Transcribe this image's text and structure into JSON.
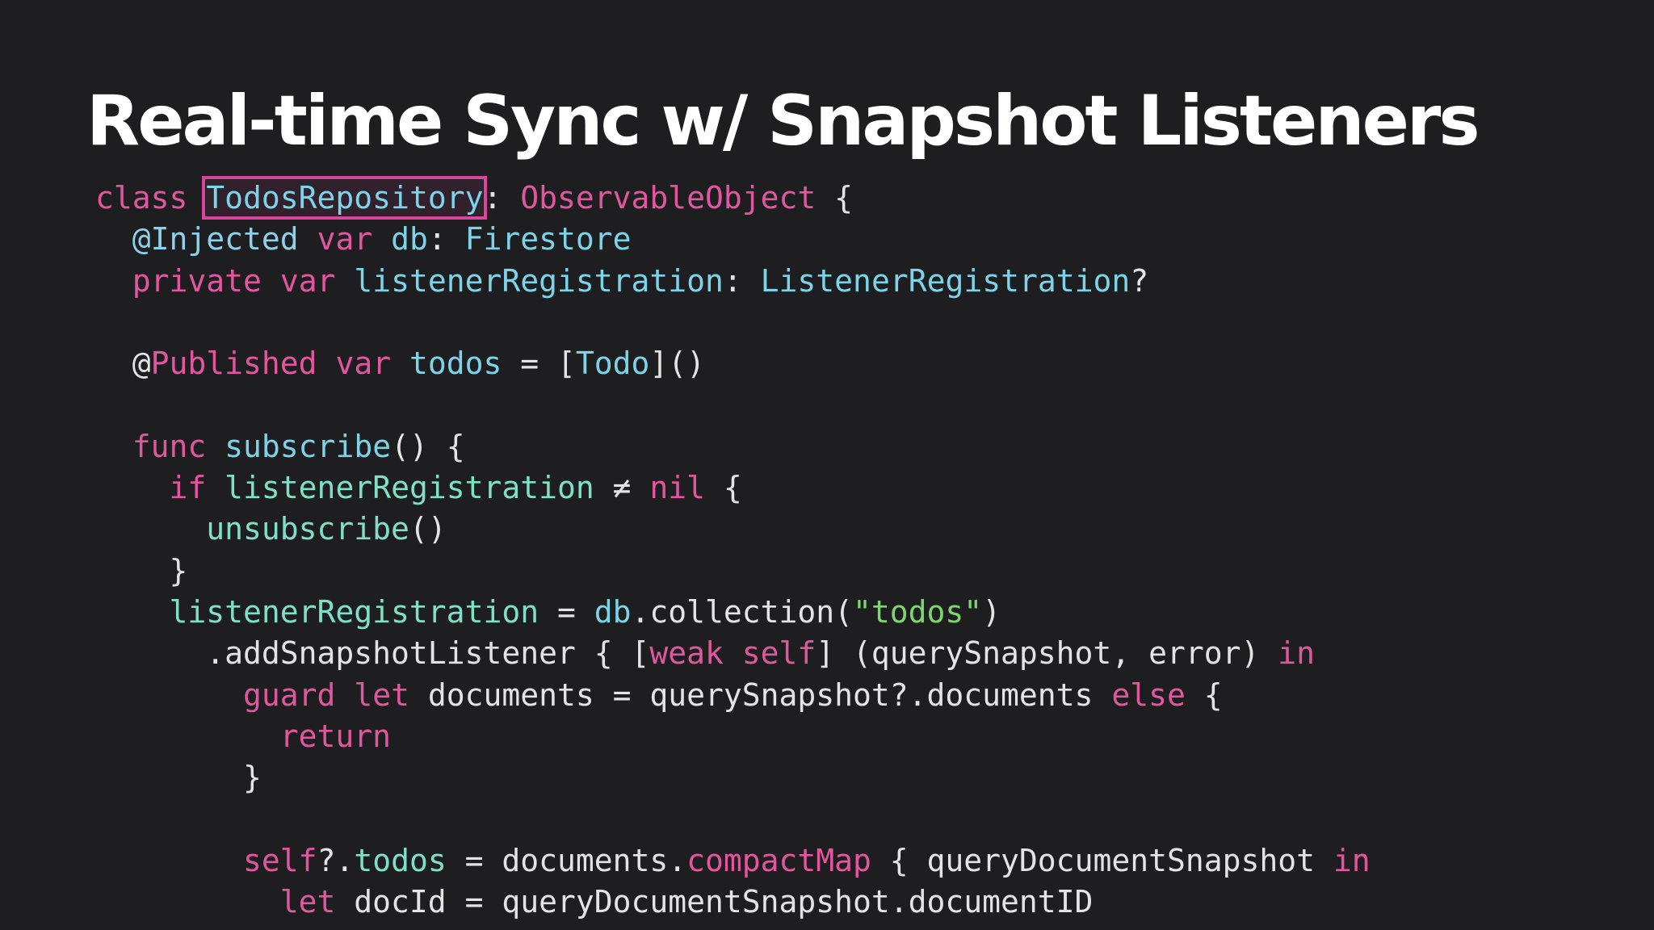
{
  "colors": {
    "background": "#1e1e20",
    "title": "#ffffff",
    "keyword": "#e0569f",
    "type": "#7dd3e8",
    "identifier": "#7fe0c6",
    "plain": "#e4e4e4",
    "string": "#7ed66e",
    "attribute": "#8fd0ea",
    "highlight": "#d9459b"
  },
  "slide": {
    "title": "Real-time Sync w/ Snapshot Listeners",
    "highlighted_token": "TodosRepository"
  },
  "code": {
    "lines": [
      [
        {
          "t": "class",
          "c": "keyword"
        },
        {
          "t": " ",
          "c": "plain"
        },
        {
          "t": "TodosRepository",
          "c": "type",
          "h": true
        },
        {
          "t": ": ",
          "c": "plain"
        },
        {
          "t": "ObservableObject",
          "c": "keyword"
        },
        {
          "t": " {",
          "c": "plain"
        }
      ],
      [
        {
          "t": "  ",
          "c": "plain"
        },
        {
          "t": "@Injected",
          "c": "attribute"
        },
        {
          "t": " ",
          "c": "plain"
        },
        {
          "t": "var",
          "c": "keyword"
        },
        {
          "t": " ",
          "c": "plain"
        },
        {
          "t": "db",
          "c": "type"
        },
        {
          "t": ": ",
          "c": "plain"
        },
        {
          "t": "Firestore",
          "c": "type"
        }
      ],
      [
        {
          "t": "  ",
          "c": "plain"
        },
        {
          "t": "private",
          "c": "keyword"
        },
        {
          "t": " ",
          "c": "plain"
        },
        {
          "t": "var",
          "c": "keyword"
        },
        {
          "t": " ",
          "c": "plain"
        },
        {
          "t": "listenerRegistration",
          "c": "type"
        },
        {
          "t": ": ",
          "c": "plain"
        },
        {
          "t": "ListenerRegistration",
          "c": "type"
        },
        {
          "t": "?",
          "c": "plain"
        }
      ],
      [],
      [
        {
          "t": "  @",
          "c": "plain"
        },
        {
          "t": "Published",
          "c": "keyword"
        },
        {
          "t": " ",
          "c": "plain"
        },
        {
          "t": "var",
          "c": "keyword"
        },
        {
          "t": " ",
          "c": "plain"
        },
        {
          "t": "todos",
          "c": "type"
        },
        {
          "t": " = [",
          "c": "plain"
        },
        {
          "t": "Todo",
          "c": "type"
        },
        {
          "t": "]()",
          "c": "plain"
        }
      ],
      [],
      [
        {
          "t": "  ",
          "c": "plain"
        },
        {
          "t": "func",
          "c": "keyword"
        },
        {
          "t": " ",
          "c": "plain"
        },
        {
          "t": "subscribe",
          "c": "type"
        },
        {
          "t": "() {",
          "c": "plain"
        }
      ],
      [
        {
          "t": "    ",
          "c": "plain"
        },
        {
          "t": "if",
          "c": "keyword"
        },
        {
          "t": " ",
          "c": "plain"
        },
        {
          "t": "listenerRegistration",
          "c": "identifier"
        },
        {
          "t": " ≠ ",
          "c": "plain"
        },
        {
          "t": "nil",
          "c": "keyword"
        },
        {
          "t": " {",
          "c": "plain"
        }
      ],
      [
        {
          "t": "      ",
          "c": "plain"
        },
        {
          "t": "unsubscribe",
          "c": "identifier"
        },
        {
          "t": "()",
          "c": "plain"
        }
      ],
      [
        {
          "t": "    }",
          "c": "plain"
        }
      ],
      [
        {
          "t": "    ",
          "c": "plain"
        },
        {
          "t": "listenerRegistration",
          "c": "identifier"
        },
        {
          "t": " = ",
          "c": "plain"
        },
        {
          "t": "db",
          "c": "type"
        },
        {
          "t": ".collection(",
          "c": "plain"
        },
        {
          "t": "\"todos\"",
          "c": "string"
        },
        {
          "t": ")",
          "c": "plain"
        }
      ],
      [
        {
          "t": "      .addSnapshotListener { [",
          "c": "plain"
        },
        {
          "t": "weak",
          "c": "keyword"
        },
        {
          "t": " ",
          "c": "plain"
        },
        {
          "t": "self",
          "c": "keyword"
        },
        {
          "t": "] (querySnapshot, error) ",
          "c": "plain"
        },
        {
          "t": "in",
          "c": "keyword"
        }
      ],
      [
        {
          "t": "        ",
          "c": "plain"
        },
        {
          "t": "guard",
          "c": "keyword"
        },
        {
          "t": " ",
          "c": "plain"
        },
        {
          "t": "let",
          "c": "keyword"
        },
        {
          "t": " documents = querySnapshot?.documents ",
          "c": "plain"
        },
        {
          "t": "else",
          "c": "keyword"
        },
        {
          "t": " {",
          "c": "plain"
        }
      ],
      [
        {
          "t": "          ",
          "c": "plain"
        },
        {
          "t": "return",
          "c": "keyword"
        }
      ],
      [
        {
          "t": "        }",
          "c": "plain"
        }
      ],
      [],
      [
        {
          "t": "        ",
          "c": "plain"
        },
        {
          "t": "self",
          "c": "keyword"
        },
        {
          "t": "?.",
          "c": "plain"
        },
        {
          "t": "todos",
          "c": "identifier"
        },
        {
          "t": " = documents.",
          "c": "plain"
        },
        {
          "t": "compactMap",
          "c": "keyword"
        },
        {
          "t": " { queryDocumentSnapshot ",
          "c": "plain"
        },
        {
          "t": "in",
          "c": "keyword"
        }
      ],
      [
        {
          "t": "          ",
          "c": "plain"
        },
        {
          "t": "let",
          "c": "keyword"
        },
        {
          "t": " docId = queryDocumentSnapshot.documentID",
          "c": "plain"
        }
      ]
    ]
  }
}
